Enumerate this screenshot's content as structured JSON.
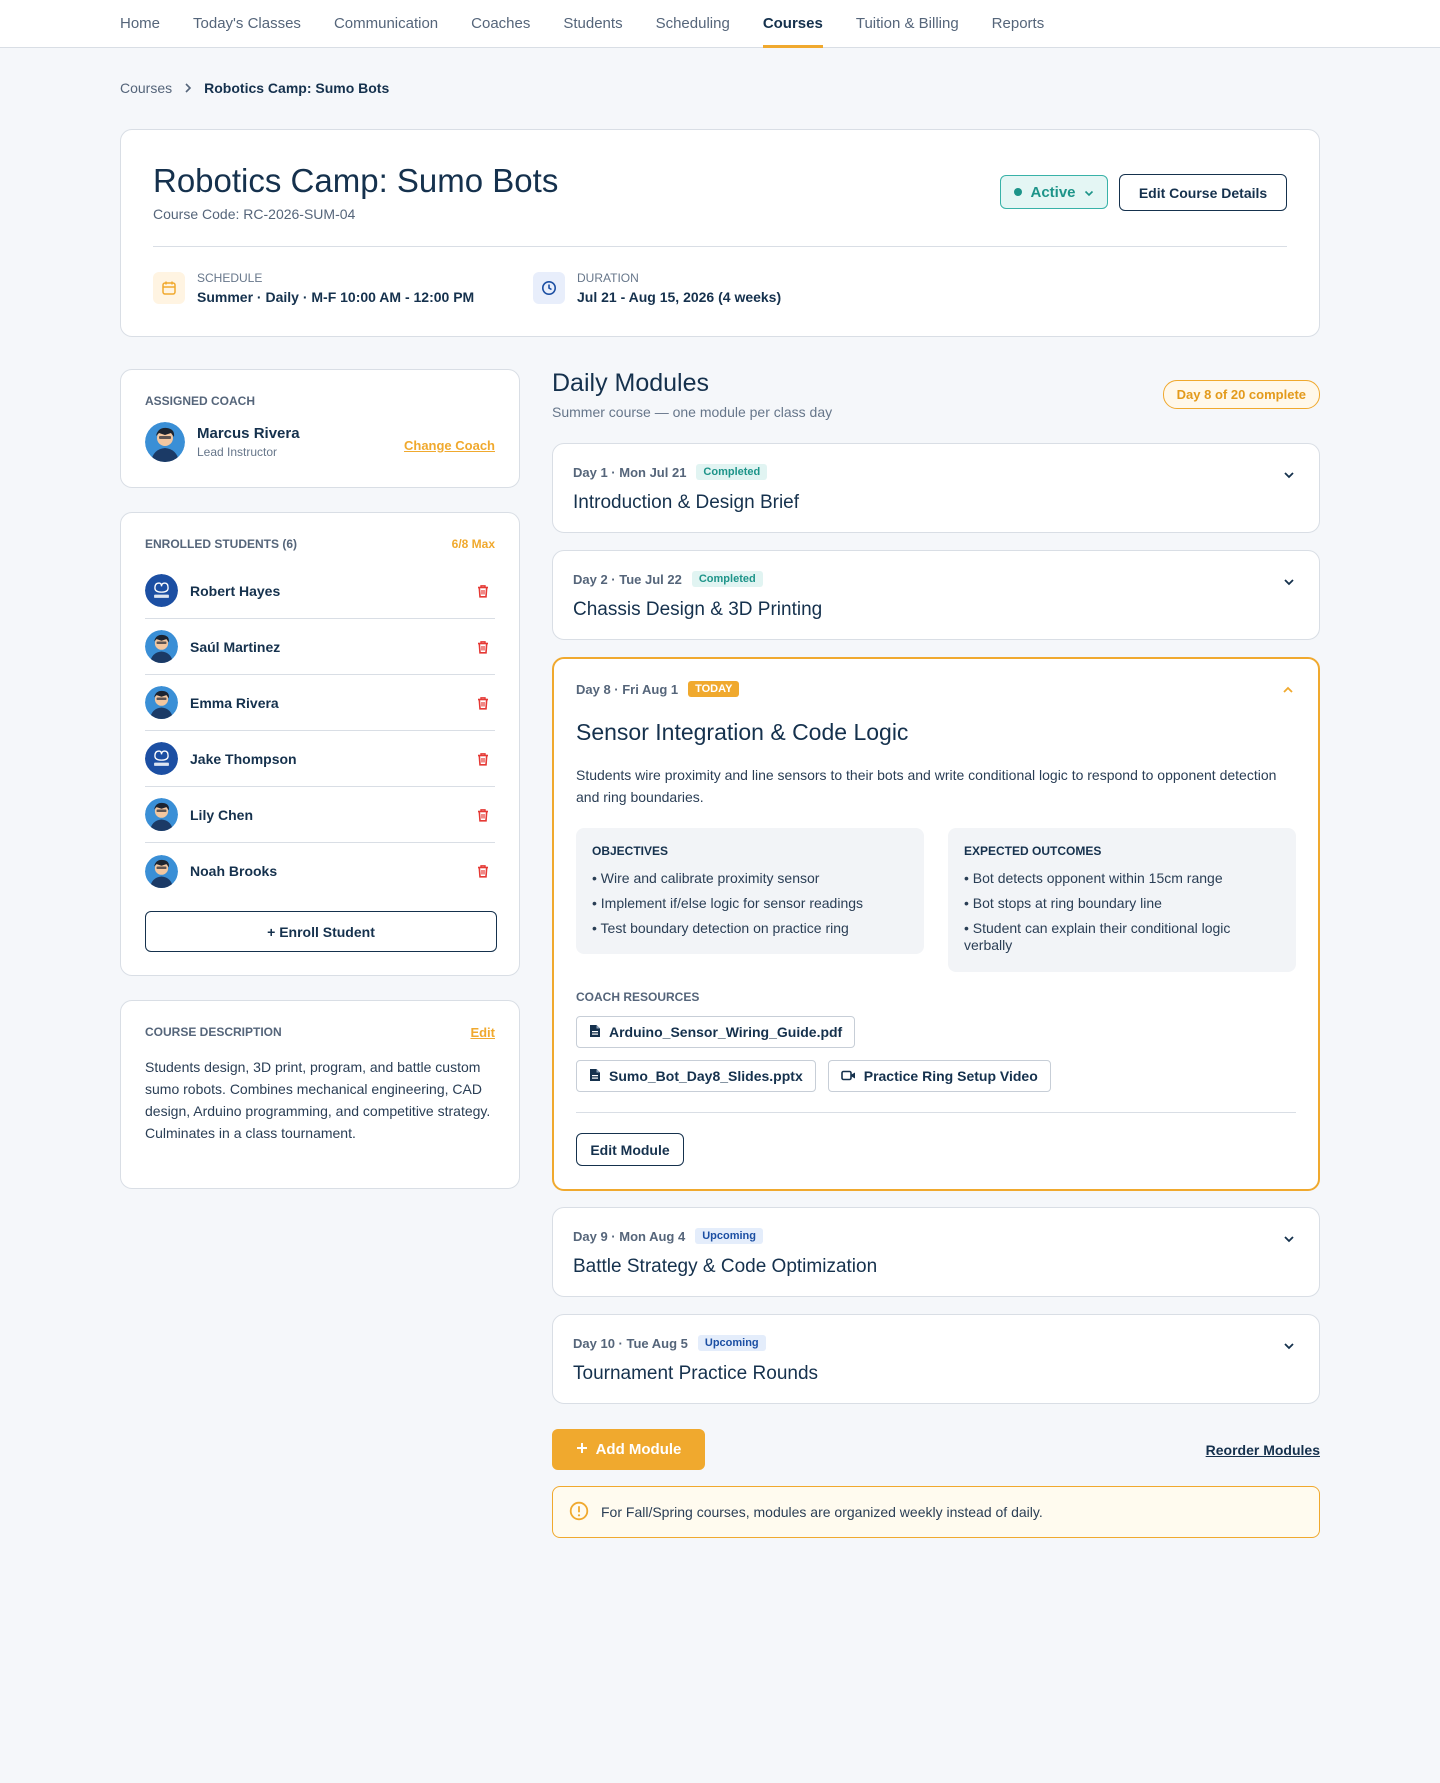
{
  "nav": {
    "items": [
      {
        "label": "Home"
      },
      {
        "label": "Today's Classes"
      },
      {
        "label": "Communication"
      },
      {
        "label": "Coaches"
      },
      {
        "label": "Students"
      },
      {
        "label": "Scheduling"
      },
      {
        "label": "Courses",
        "active": true
      },
      {
        "label": "Tuition & Billing"
      },
      {
        "label": "Reports"
      }
    ]
  },
  "breadcrumb": {
    "parent": "Courses",
    "current": "Robotics Camp: Sumo Bots"
  },
  "course": {
    "title": "Robotics Camp: Sumo Bots",
    "code": "Course Code: RC-2026-SUM-04",
    "status": "Active",
    "edit_label": "Edit Course Details",
    "schedule_label": "SCHEDULE",
    "schedule_value": "Summer · Daily · M-F 10:00 AM - 12:00 PM",
    "duration_label": "DURATION",
    "duration_value": "Jul 21 - Aug 15, 2026 (4 weeks)"
  },
  "coach": {
    "section_label": "ASSIGNED COACH",
    "name": "Marcus Rivera",
    "role": "Lead Instructor",
    "change_label": "Change Coach"
  },
  "students": {
    "section_label": "ENROLLED STUDENTS (6)",
    "max_label": "6/8 Max",
    "list": [
      {
        "name": "Robert Hayes",
        "avatar": "logo-avatar"
      },
      {
        "name": "Saúl Martinez",
        "avatar": "person-avatar"
      },
      {
        "name": "Emma Rivera",
        "avatar": "person-avatar"
      },
      {
        "name": "Jake Thompson",
        "avatar": "logo-avatar"
      },
      {
        "name": "Lily Chen",
        "avatar": "person-avatar"
      },
      {
        "name": "Noah Brooks",
        "avatar": "person-avatar"
      }
    ],
    "enroll_label": "+ Enroll Student"
  },
  "description": {
    "section_label": "COURSE DESCRIPTION",
    "edit_label": "Edit",
    "text": "Students design, 3D print, program, and battle custom sumo robots. Combines mechanical engineering, CAD design, Arduino programming, and competitive strategy. Culminates in a class tournament."
  },
  "modules": {
    "title": "Daily Modules",
    "subtitle": "Summer course — one module per class day",
    "progress": "Day 8 of 20 complete",
    "items": [
      {
        "day": "Day 1 · Mon Jul 21",
        "status": "Completed",
        "title": "Introduction & Design Brief"
      },
      {
        "day": "Day 2 · Tue Jul 22",
        "status": "Completed",
        "title": "Chassis Design & 3D Printing"
      },
      {
        "day": "Day 8 · Fri Aug 1",
        "status": "Today",
        "title": "Sensor Integration & Code Logic"
      },
      {
        "day": "Day 9 · Mon Aug 4",
        "status": "Upcoming",
        "title": "Battle Strategy & Code Optimization"
      },
      {
        "day": "Day 10 · Tue Aug 5",
        "status": "Upcoming",
        "title": "Tournament Practice Rounds"
      }
    ],
    "open": {
      "description": "Students wire proximity and line sensors to their bots and write conditional logic to respond to opponent detection and ring boundaries.",
      "objectives_title": "OBJECTIVES",
      "objectives": [
        "• Wire and calibrate proximity sensor",
        "• Implement if/else logic for sensor readings",
        "• Test boundary detection on practice ring"
      ],
      "outcomes_title": "EXPECTED OUTCOMES",
      "outcomes": [
        "• Bot detects opponent within 15cm range",
        "• Bot stops at ring boundary line",
        "• Student can explain their conditional logic verbally"
      ],
      "resources_label": "COACH RESOURCES",
      "resources": [
        {
          "name": "Arduino_Sensor_Wiring_Guide.pdf",
          "icon": "document-icon"
        },
        {
          "name": "Sumo_Bot_Day8_Slides.pptx",
          "icon": "document-icon"
        },
        {
          "name": "Practice Ring Setup Video",
          "icon": "video-icon"
        }
      ],
      "edit_label": "Edit Module"
    },
    "add_label": "Add Module",
    "reorder_label": "Reorder Modules",
    "notice": "For Fall/Spring courses, modules are organized weekly instead of daily."
  },
  "colors": {
    "accent": "#f0a92e",
    "navy": "#15314d",
    "teal": "#1d9489",
    "danger": "#e53935"
  }
}
